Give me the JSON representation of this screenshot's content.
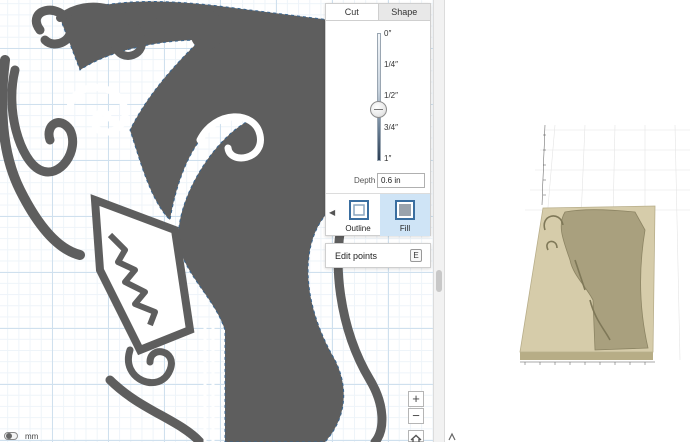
{
  "cut_panel": {
    "tabs": [
      {
        "label": "Cut",
        "active": true
      },
      {
        "label": "Shape",
        "active": false
      }
    ],
    "depth_ticks": [
      "0″",
      "1/4″",
      "1/2″",
      "3/4″",
      "1″"
    ],
    "slider_value_fraction": 0.6,
    "depth_label": "Depth",
    "depth_value": "0.6 in",
    "modes": [
      {
        "label": "Outline",
        "selected": false
      },
      {
        "label": "Fill",
        "selected": true
      }
    ]
  },
  "edit_points": {
    "label": "Edit points",
    "shortcut": "E"
  },
  "zoom": {
    "in_label": "+",
    "out_label": "−"
  },
  "units": {
    "label": "mm"
  },
  "colors": {
    "art_fill": "#5e5e5e",
    "selection_outline": "#2e6da4",
    "panel_selected": "#cfe4f6",
    "wood_light": "#d6ccaa",
    "wood_carved": "#a9a07e"
  },
  "icons": {
    "zoom_in": "plus-icon",
    "zoom_out": "minus-icon",
    "home": "home-icon",
    "collapse": "chevron-left-icon"
  }
}
